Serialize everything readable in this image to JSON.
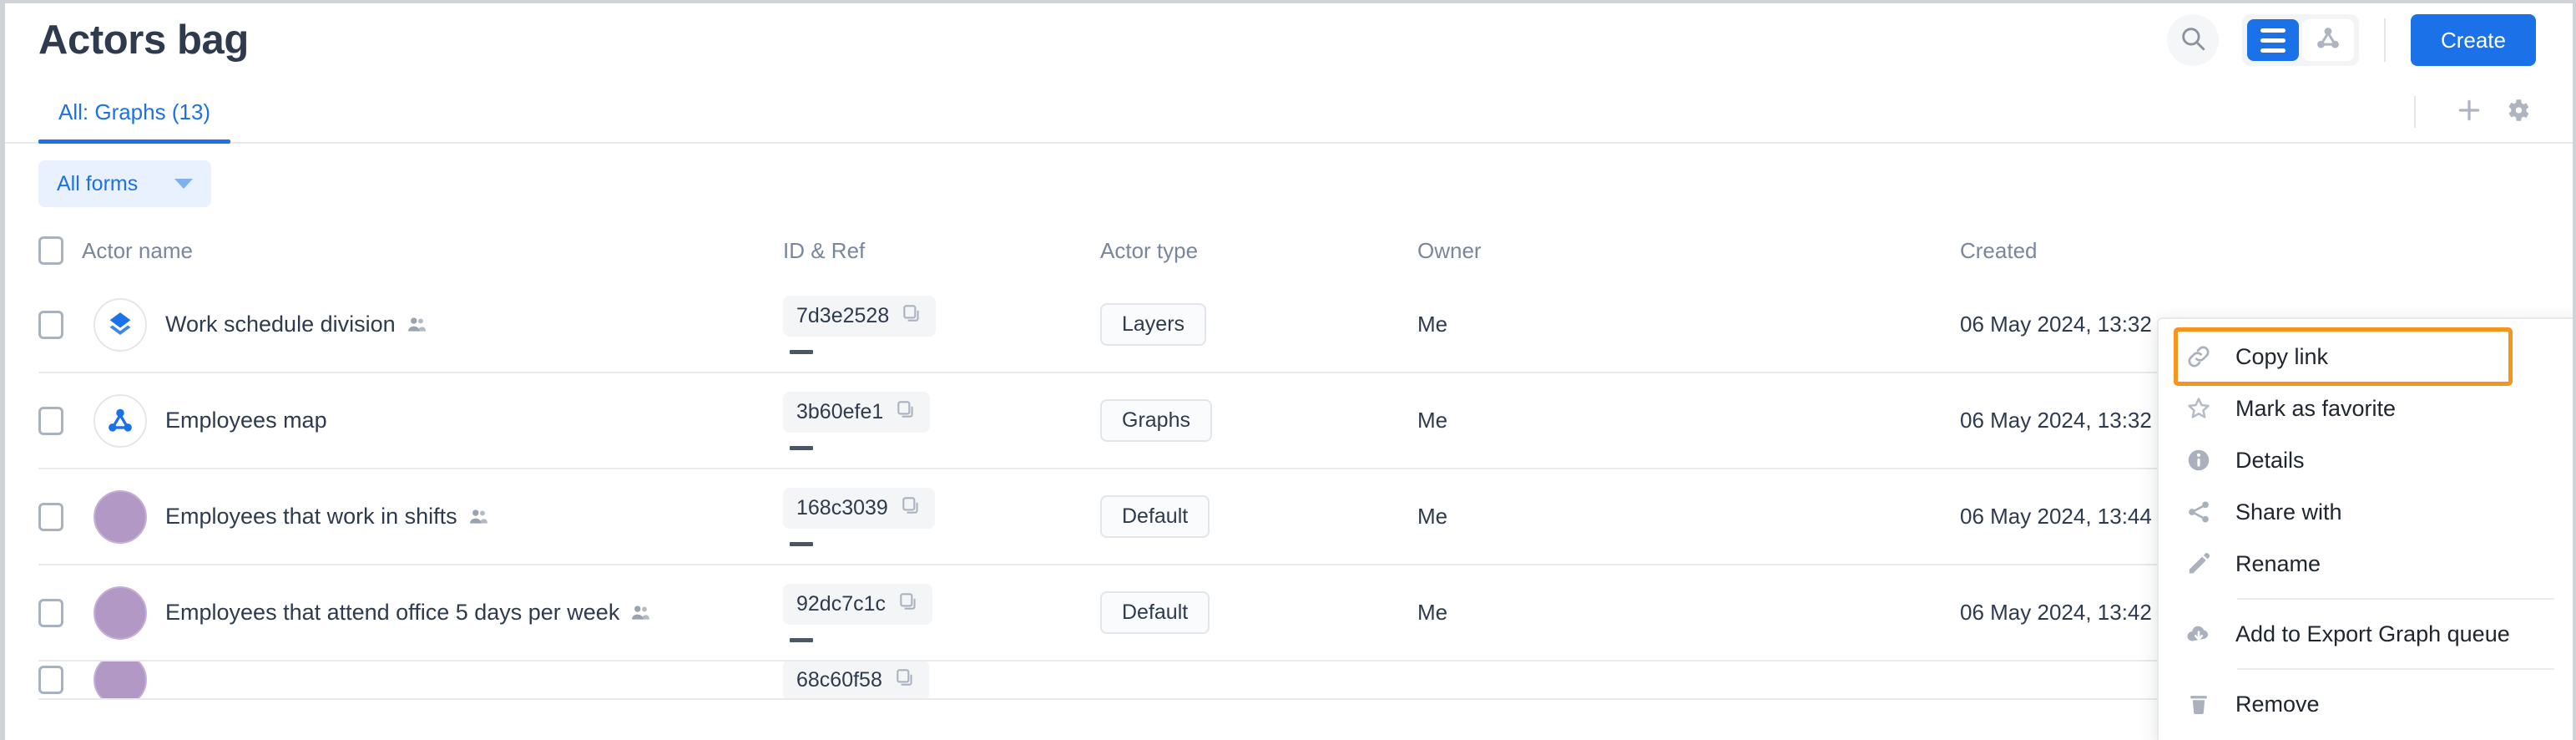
{
  "header": {
    "title": "Actors bag",
    "search_icon": "search-icon",
    "view_list_icon": "list-view-icon",
    "view_graph_icon": "graph-view-icon",
    "create_label": "Create"
  },
  "tabbar": {
    "tabs": [
      {
        "label": "All: Graphs (13)",
        "active": true
      }
    ],
    "add_icon": "plus-icon",
    "settings_icon": "gear-icon"
  },
  "filter": {
    "label": "All forms",
    "caret_icon": "chevron-down-icon"
  },
  "table": {
    "columns": [
      {
        "key": "name",
        "label": "Actor name"
      },
      {
        "key": "id",
        "label": "ID & Ref"
      },
      {
        "key": "type",
        "label": "Actor type"
      },
      {
        "key": "owner",
        "label": "Owner"
      },
      {
        "key": "date",
        "label": "Created"
      }
    ],
    "rows": [
      {
        "name": "Work schedule division",
        "shared": true,
        "avatar": "layers-icon",
        "id": "7d3e2528",
        "ref": "—",
        "type": "Layers",
        "owner": "Me",
        "created": "06 May 2024, 13:32"
      },
      {
        "name": "Employees map",
        "shared": false,
        "avatar": "graph-icon",
        "id": "3b60efe1",
        "ref": "—",
        "type": "Graphs",
        "owner": "Me",
        "created": "06 May 2024, 13:32"
      },
      {
        "name": "Employees that work in shifts",
        "shared": true,
        "avatar": "purple-circle",
        "id": "168c3039",
        "ref": "—",
        "type": "Default",
        "owner": "Me",
        "created": "06 May 2024, 13:44"
      },
      {
        "name": "Employees that attend office 5 days per week",
        "shared": true,
        "avatar": "purple-circle",
        "id": "92dc7c1c",
        "ref": "—",
        "type": "Default",
        "owner": "Me",
        "created": "06 May 2024, 13:42"
      }
    ],
    "partial_row": {
      "id": "68c60f58"
    },
    "copy_icon": "copy-icon"
  },
  "context_menu": {
    "highlight_color": "#f7941e",
    "items": [
      {
        "label": "Copy link",
        "icon": "link-icon",
        "highlighted": true,
        "separator_after": false
      },
      {
        "label": "Mark as favorite",
        "icon": "star-icon",
        "highlighted": false,
        "separator_after": false
      },
      {
        "label": "Details",
        "icon": "info-icon",
        "highlighted": false,
        "separator_after": false
      },
      {
        "label": "Share with",
        "icon": "share-icon",
        "highlighted": false,
        "separator_after": false
      },
      {
        "label": "Rename",
        "icon": "pencil-icon",
        "highlighted": false,
        "separator_after": true
      },
      {
        "label": "Add to Export Graph queue",
        "icon": "cloud-down-icon",
        "highlighted": false,
        "separator_after": true
      },
      {
        "label": "Remove",
        "icon": "trash-icon",
        "highlighted": false,
        "separator_after": false
      }
    ]
  },
  "colors": {
    "accent": "#1b72e8",
    "highlight": "#f7941e",
    "purple": "#b298c4",
    "text": "#2e3a4d",
    "muted": "#79869c"
  }
}
